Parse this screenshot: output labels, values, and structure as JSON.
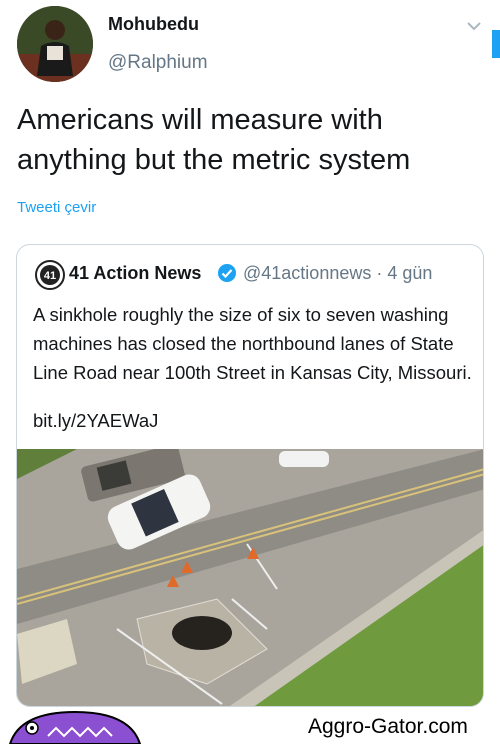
{
  "tweet": {
    "author_name": "Mohubedu",
    "author_handle": "@Ralphium",
    "text": "Americans will measure with anything but the metric system",
    "translate_label": "Tweeti çevir"
  },
  "quoted": {
    "logo_text": "41",
    "name": "41 Action News",
    "handle_and_time": "@41actionnews · 4 gün",
    "text": "A sinkhole roughly the size of six to seven washing machines has closed the northbound lanes of State Line Road near 100th Street in Kansas City, Missouri.",
    "link": "bit.ly/2YAEWaJ"
  },
  "footer": {
    "site": "Aggro-Gator.com"
  },
  "colors": {
    "link_blue": "#1da1f2",
    "secondary_gray": "#657786",
    "grass_green": "#6a9a3c",
    "mascot_purple": "#8b4fd1"
  }
}
